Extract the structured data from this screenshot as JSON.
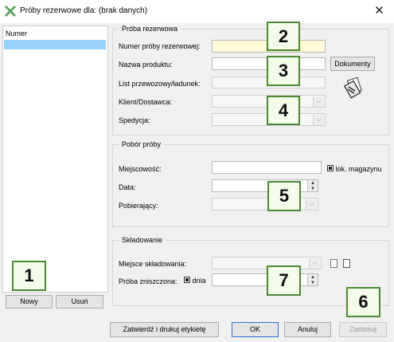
{
  "window": {
    "title": "Próby rezerwowe dla: (brak danych)",
    "close_glyph": "✕",
    "app_icon": "excel-x-icon"
  },
  "left_panel": {
    "column_header": "Numer",
    "add_button": "Nowy",
    "remove_button": "Usuń"
  },
  "group_sample": {
    "legend": "Próba rezerwowa",
    "sample_number_label": "Numer próby rezerwowej:",
    "sample_number_value": "",
    "product_name_label": "Nazwa produktu:",
    "product_name_value": "",
    "documents_button": "Dokumenty",
    "waybill_label": "List przewozowy/ładunek:",
    "client_label": "Klient/Dostawca:",
    "shipping_label": "Spedycja:",
    "books_icon": "documents-stack-icon"
  },
  "group_collection": {
    "legend": "Pobór próby",
    "location_label": "Miejscowość:",
    "local_storage_label": "lok. magazynu",
    "date_label": "Data:",
    "collector_label": "Pobierający:"
  },
  "group_storage": {
    "legend": "Składowanie",
    "storage_place_label": "Miejsce składowania:",
    "destroyed_label": "Próba zniszczona:",
    "day_label": "dnia"
  },
  "footer": {
    "confirm_print_button": "Zatwierdź i drukuj etykietę",
    "ok_button": "OK",
    "cancel_button": "Anuluj",
    "save_button": "Zastosuj"
  },
  "badges": {
    "b1": "1",
    "b2": "2",
    "b3": "3",
    "b4": "4",
    "b5": "5",
    "b6": "6",
    "b7": "7"
  },
  "colors": {
    "selection": "#99d1f7",
    "badge_border": "#4a8a30",
    "required_field": "#fffbd6",
    "focus_border": "#2d6fd3"
  }
}
